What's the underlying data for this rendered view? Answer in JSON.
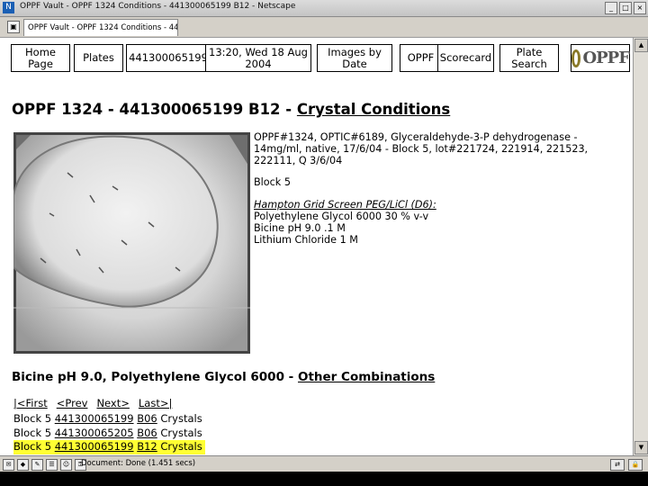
{
  "window": {
    "title": "OPPF Vault - OPPF 1324 Conditions - 441300065199 B12 - Netscape",
    "tab_label": "OPPF Vault - OPPF 1324 Conditions - 4413...",
    "controls": [
      "_",
      "□",
      "×"
    ]
  },
  "nav": {
    "home": "Home Page",
    "plates": "Plates",
    "barcode": "441300065199",
    "datetime": "13:20, Wed 18 Aug 2004",
    "images_by_date": "Images by Date",
    "oppf": "OPPF",
    "scorecard": "Scorecard",
    "plate_search": "Plate Search",
    "logo": "OPPF"
  },
  "page": {
    "heading_prefix": "OPPF 1324 - 441300065199 B12 - ",
    "heading_link": "Crystal Conditions"
  },
  "info": {
    "protein": "OPPF#1324, OPTIC#6189, Glyceraldehyde-3-P dehydrogenase - 14mg/ml, native, 17/6/04 - Block 5, lot#221724, 221914, 221523, 222111, Q 3/6/04",
    "block": "Block 5",
    "screen": "Hampton Grid Screen PEG/LiCl (D6):",
    "conditions": [
      "Polyethylene Glycol 6000 30 % v-v",
      "Bicine pH 9.0 .1 M",
      "Lithium Chloride 1 M"
    ]
  },
  "combinations": {
    "heading_prefix": "Bicine pH 9.0, Polyethylene Glycol 6000 - ",
    "heading_link": "Other Combinations",
    "pager": [
      "|<First",
      "<Prev",
      "Next>",
      "Last>|"
    ],
    "rows": [
      {
        "block": "Block 5",
        "plate": "441300065199",
        "well": "B06",
        "status": "Crystals",
        "highlight": false
      },
      {
        "block": "Block 5",
        "plate": "441300065205",
        "well": "B06",
        "status": "Crystals",
        "highlight": false
      },
      {
        "block": "Block 5",
        "plate": "441300065199",
        "well": "B12",
        "status": "Crystals",
        "highlight": true
      }
    ]
  },
  "status": {
    "text": "Document: Done (1.451 secs)"
  },
  "colors": {
    "highlight": "#ffff33",
    "chrome": "#d4d0c8"
  }
}
